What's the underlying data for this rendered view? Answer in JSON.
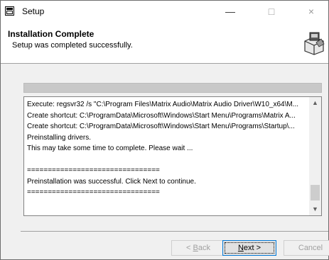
{
  "window": {
    "title": "Setup",
    "controls": {
      "minimize": "—",
      "maximize": "□",
      "close": "×"
    },
    "app_icon": "setup-app-icon"
  },
  "header": {
    "title": "Installation Complete",
    "subtitle": "Setup was completed successfully.",
    "icon": "installer-box-icon"
  },
  "progress": {
    "percent": 100
  },
  "log": {
    "lines": [
      "Execute: regsvr32 /s \"C:\\Program Files\\Matrix Audio\\Matrix Audio Driver\\W10_x64\\M...",
      "Create shortcut: C:\\ProgramData\\Microsoft\\Windows\\Start Menu\\Programs\\Matrix A...",
      "Create shortcut: C:\\ProgramData\\Microsoft\\Windows\\Start Menu\\Programs\\Startup\\...",
      "Preinstalling drivers.",
      "This may take some time to complete. Please wait ...",
      "",
      "================================",
      "Preinstallation was successful. Click Next to continue.",
      "================================"
    ]
  },
  "buttons": {
    "back": {
      "prefix": "< ",
      "accel": "B",
      "rest": "ack"
    },
    "next": {
      "accel": "N",
      "rest": "ext >"
    },
    "cancel": "Cancel"
  }
}
